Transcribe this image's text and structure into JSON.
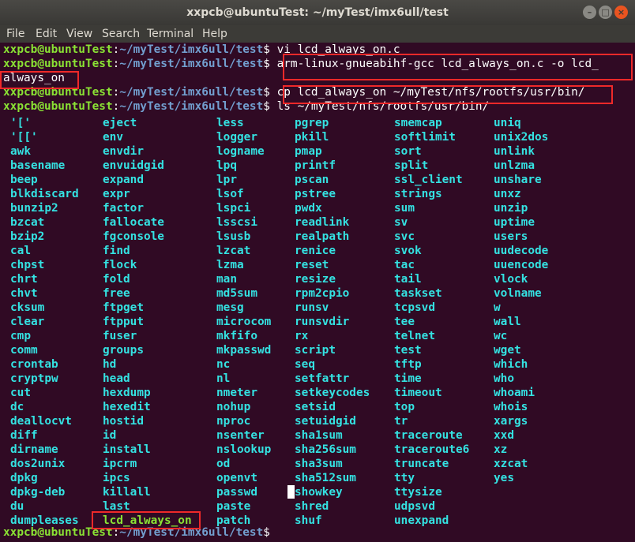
{
  "window": {
    "title": "xxpcb@ubuntuTest: ~/myTest/imx6ull/test",
    "controls": {
      "minimize": "–",
      "maximize": "□",
      "close": "×"
    }
  },
  "menu": [
    "File",
    "Edit",
    "View",
    "Search",
    "Terminal",
    "Help"
  ],
  "prompt": {
    "user": "xxpcb@ubuntuTest",
    "colon": ":",
    "path": "~/myTest/imx6ull/test",
    "dollar": "$ "
  },
  "commands": [
    "vi lcd_always_on.c",
    "arm-linux-gnueabihf-gcc lcd_always_on.c -o lcd_",
    "always_on",
    "cp lcd_always_on ~/myTest/nfs/rootfs/usr/bin/",
    "ls ~/myTest/nfs/rootfs/usr/bin/"
  ],
  "listing": [
    [
      "'['",
      "eject",
      "less",
      "pgrep",
      "smemcap",
      "uniq"
    ],
    [
      "'[['",
      "env",
      "logger",
      "pkill",
      "softlimit",
      "unix2dos"
    ],
    [
      "awk",
      "envdir",
      "logname",
      "pmap",
      "sort",
      "unlink"
    ],
    [
      "basename",
      "envuidgid",
      "lpq",
      "printf",
      "split",
      "unlzma"
    ],
    [
      "beep",
      "expand",
      "lpr",
      "pscan",
      "ssl_client",
      "unshare"
    ],
    [
      "blkdiscard",
      "expr",
      "lsof",
      "pstree",
      "strings",
      "unxz"
    ],
    [
      "bunzip2",
      "factor",
      "lspci",
      "pwdx",
      "sum",
      "unzip"
    ],
    [
      "bzcat",
      "fallocate",
      "lsscsi",
      "readlink",
      "sv",
      "uptime"
    ],
    [
      "bzip2",
      "fgconsole",
      "lsusb",
      "realpath",
      "svc",
      "users"
    ],
    [
      "cal",
      "find",
      "lzcat",
      "renice",
      "svok",
      "uudecode"
    ],
    [
      "chpst",
      "flock",
      "lzma",
      "reset",
      "tac",
      "uuencode"
    ],
    [
      "chrt",
      "fold",
      "man",
      "resize",
      "tail",
      "vlock"
    ],
    [
      "chvt",
      "free",
      "md5sum",
      "rpm2cpio",
      "taskset",
      "volname"
    ],
    [
      "cksum",
      "ftpget",
      "mesg",
      "runsv",
      "tcpsvd",
      "w"
    ],
    [
      "clear",
      "ftpput",
      "microcom",
      "runsvdir",
      "tee",
      "wall"
    ],
    [
      "cmp",
      "fuser",
      "mkfifo",
      "rx",
      "telnet",
      "wc"
    ],
    [
      "comm",
      "groups",
      "mkpasswd",
      "script",
      "test",
      "wget"
    ],
    [
      "crontab",
      "hd",
      "nc",
      "seq",
      "tftp",
      "which"
    ],
    [
      "cryptpw",
      "head",
      "nl",
      "setfattr",
      "time",
      "who"
    ],
    [
      "cut",
      "hexdump",
      "nmeter",
      "setkeycodes",
      "timeout",
      "whoami"
    ],
    [
      "dc",
      "hexedit",
      "nohup",
      "setsid",
      "top",
      "whois"
    ],
    [
      "deallocvt",
      "hostid",
      "nproc",
      "setuidgid",
      "tr",
      "xargs"
    ],
    [
      "diff",
      "id",
      "nsenter",
      "sha1sum",
      "traceroute",
      "xxd"
    ],
    [
      "dirname",
      "install",
      "nslookup",
      "sha256sum",
      "traceroute6",
      "xz"
    ],
    [
      "dos2unix",
      "ipcrm",
      "od",
      "sha3sum",
      "truncate",
      "xzcat"
    ],
    [
      "dpkg",
      "ipcs",
      "openvt",
      "sha512sum",
      "tty",
      "yes"
    ],
    [
      "dpkg-deb",
      "killall",
      "passwd",
      "showkey",
      "ttysize",
      ""
    ],
    [
      "du",
      "last",
      "paste",
      "shred",
      "udpsvd",
      ""
    ],
    [
      "dumpleases",
      "lcd_always_on",
      "patch",
      "shuf",
      "unexpand",
      ""
    ]
  ],
  "colors": {
    "background": "#300a24",
    "user": "#8ae234",
    "path": "#729fcf",
    "link": "#34e2e2",
    "executable": "#8ae234",
    "annotation": "#ef2929"
  }
}
